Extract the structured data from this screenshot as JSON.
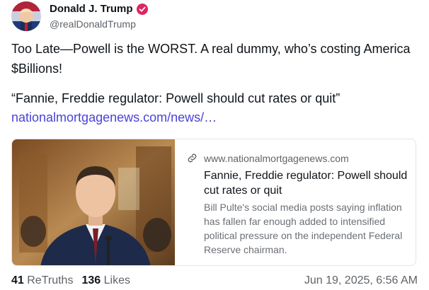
{
  "author": {
    "name": "Donald J. Trump",
    "handle": "@realDonaldTrump",
    "avatar_icon": "avatar-portrait",
    "verified_icon": "verified-badge-icon",
    "verified_color": "#e0245e"
  },
  "post": {
    "text": "Too Late—Powell is the WORST. A real dummy, who’s costing America $Billions!",
    "quote": "“Fannie, Freddie regulator: Powell should cut rates or quit”",
    "link_text": "nationalmortgagenews.com/news/…",
    "link_color": "#4a43d6"
  },
  "card": {
    "domain": "www.nationalmortgagenews.com",
    "title": "Fannie, Freddie regulator: Powell should cut rates or quit",
    "description": "Bill Pulte's social media posts saying inflation has fallen far enough added to intensified political pressure on the independent Federal Reserve chairman.",
    "link_icon": "link-icon",
    "image": "photo-man-in-suit-at-hearing"
  },
  "stats": {
    "retruths_count": "41",
    "retruths_label": "ReTruths",
    "likes_count": "136",
    "likes_label": "Likes"
  },
  "timestamp": "Jun 19, 2025, 6:56 AM"
}
